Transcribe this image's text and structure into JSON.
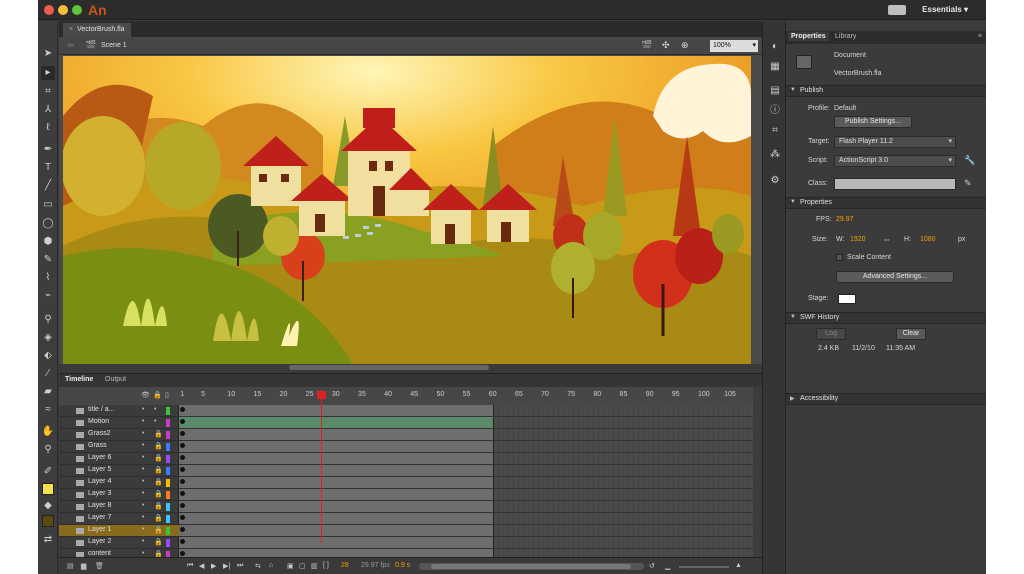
{
  "app": {
    "logo": "An",
    "workspace": "Essentials ▾"
  },
  "doc": {
    "tab": "VectorBrush.fla",
    "scene": "Scene 1",
    "zoom": "100%"
  },
  "timeline": {
    "tabs": [
      "Timeline",
      "Output"
    ],
    "ruler": [
      "1",
      "5",
      "10",
      "15",
      "20",
      "25",
      "30",
      "35",
      "40",
      "45",
      "50",
      "55",
      "60",
      "65",
      "70",
      "75",
      "80",
      "85",
      "90",
      "95",
      "100",
      "105"
    ],
    "layers": [
      {
        "name": "title / a...",
        "color": "#3cc33c"
      },
      {
        "name": "Motion",
        "color": "#c83cc8"
      },
      {
        "name": "Grass2",
        "color": "#c83cc8"
      },
      {
        "name": "Grass",
        "color": "#3c7cff"
      },
      {
        "name": "Layer 6",
        "color": "#9b4bff"
      },
      {
        "name": "Layer 5",
        "color": "#3c7cff"
      },
      {
        "name": "Layer 4",
        "color": "#f0c000"
      },
      {
        "name": "Layer 3",
        "color": "#ff7c1e"
      },
      {
        "name": "Layer 8",
        "color": "#3cc3ff"
      },
      {
        "name": "Layer 7",
        "color": "#3cc3ff"
      },
      {
        "name": "Layer 1",
        "color": "#3cc33c",
        "selected": true
      },
      {
        "name": "Layer 2",
        "color": "#9b4bff"
      },
      {
        "name": "content",
        "color": "#c83cc8"
      }
    ],
    "footer": {
      "frame": "28",
      "fps": "29.97 fps",
      "time": "0.9 s"
    }
  },
  "props": {
    "tabs": [
      "Properties",
      "Library"
    ],
    "doc_label": "Document",
    "doc_name": "VectorBrush.fla",
    "publish": {
      "header": "Publish",
      "profile_label": "Profile:",
      "profile": "Default",
      "settings_btn": "Publish Settings...",
      "target_label": "Target:",
      "target": "Flash Player 11.2",
      "script_label": "Script:",
      "script": "ActionScript 3.0",
      "class_label": "Class:"
    },
    "properties": {
      "header": "Properties",
      "fps_label": "FPS:",
      "fps": "29.97",
      "size_label": "Size:",
      "w_label": "W:",
      "w": "1920",
      "h_label": "H:",
      "h": "1080",
      "unit": "px",
      "scale": "Scale Content",
      "adv_btn": "Advanced Settings...",
      "stage_label": "Stage:"
    },
    "swf": {
      "header": "SWF History",
      "log": "Log",
      "clear": "Clear",
      "size": "2.4 KB",
      "date": "11/2/10",
      "time": "11:35 AM"
    },
    "accessibility": "Accessibility"
  }
}
